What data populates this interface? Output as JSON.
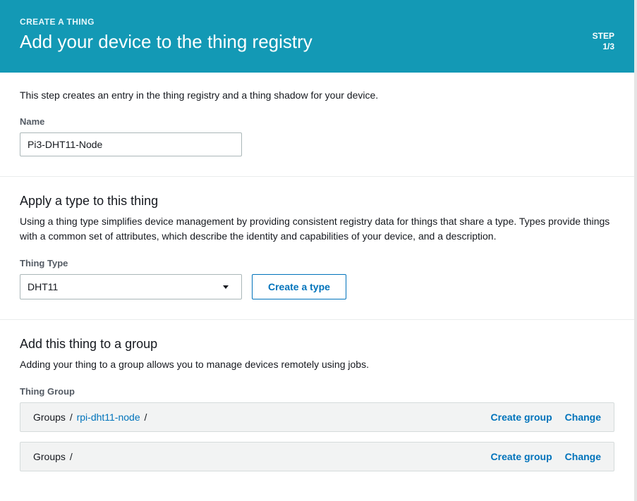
{
  "header": {
    "breadcrumb": "CREATE A THING",
    "title": "Add your device to the thing registry",
    "step_label": "STEP",
    "step_count": "1/3"
  },
  "name_section": {
    "description": "This step creates an entry in the thing registry and a thing shadow for your device.",
    "label": "Name",
    "value": "Pi3-DHT11-Node"
  },
  "type_section": {
    "title": "Apply a type to this thing",
    "description": "Using a thing type simplifies device management by providing consistent registry data for things that share a type. Types provide things with a common set of attributes, which describe the identity and capabilities of your device, and a description.",
    "label": "Thing Type",
    "selected": "DHT11",
    "create_button": "Create a type"
  },
  "group_section": {
    "title": "Add this thing to a group",
    "description": "Adding your thing to a group allows you to manage devices remotely using jobs.",
    "label": "Thing Group",
    "groups": [
      {
        "root": "Groups",
        "node": "rpi-dht11-node",
        "trailing": true
      },
      {
        "root": "Groups",
        "node": "",
        "trailing": false
      }
    ],
    "create_group": "Create group",
    "change": "Change"
  }
}
